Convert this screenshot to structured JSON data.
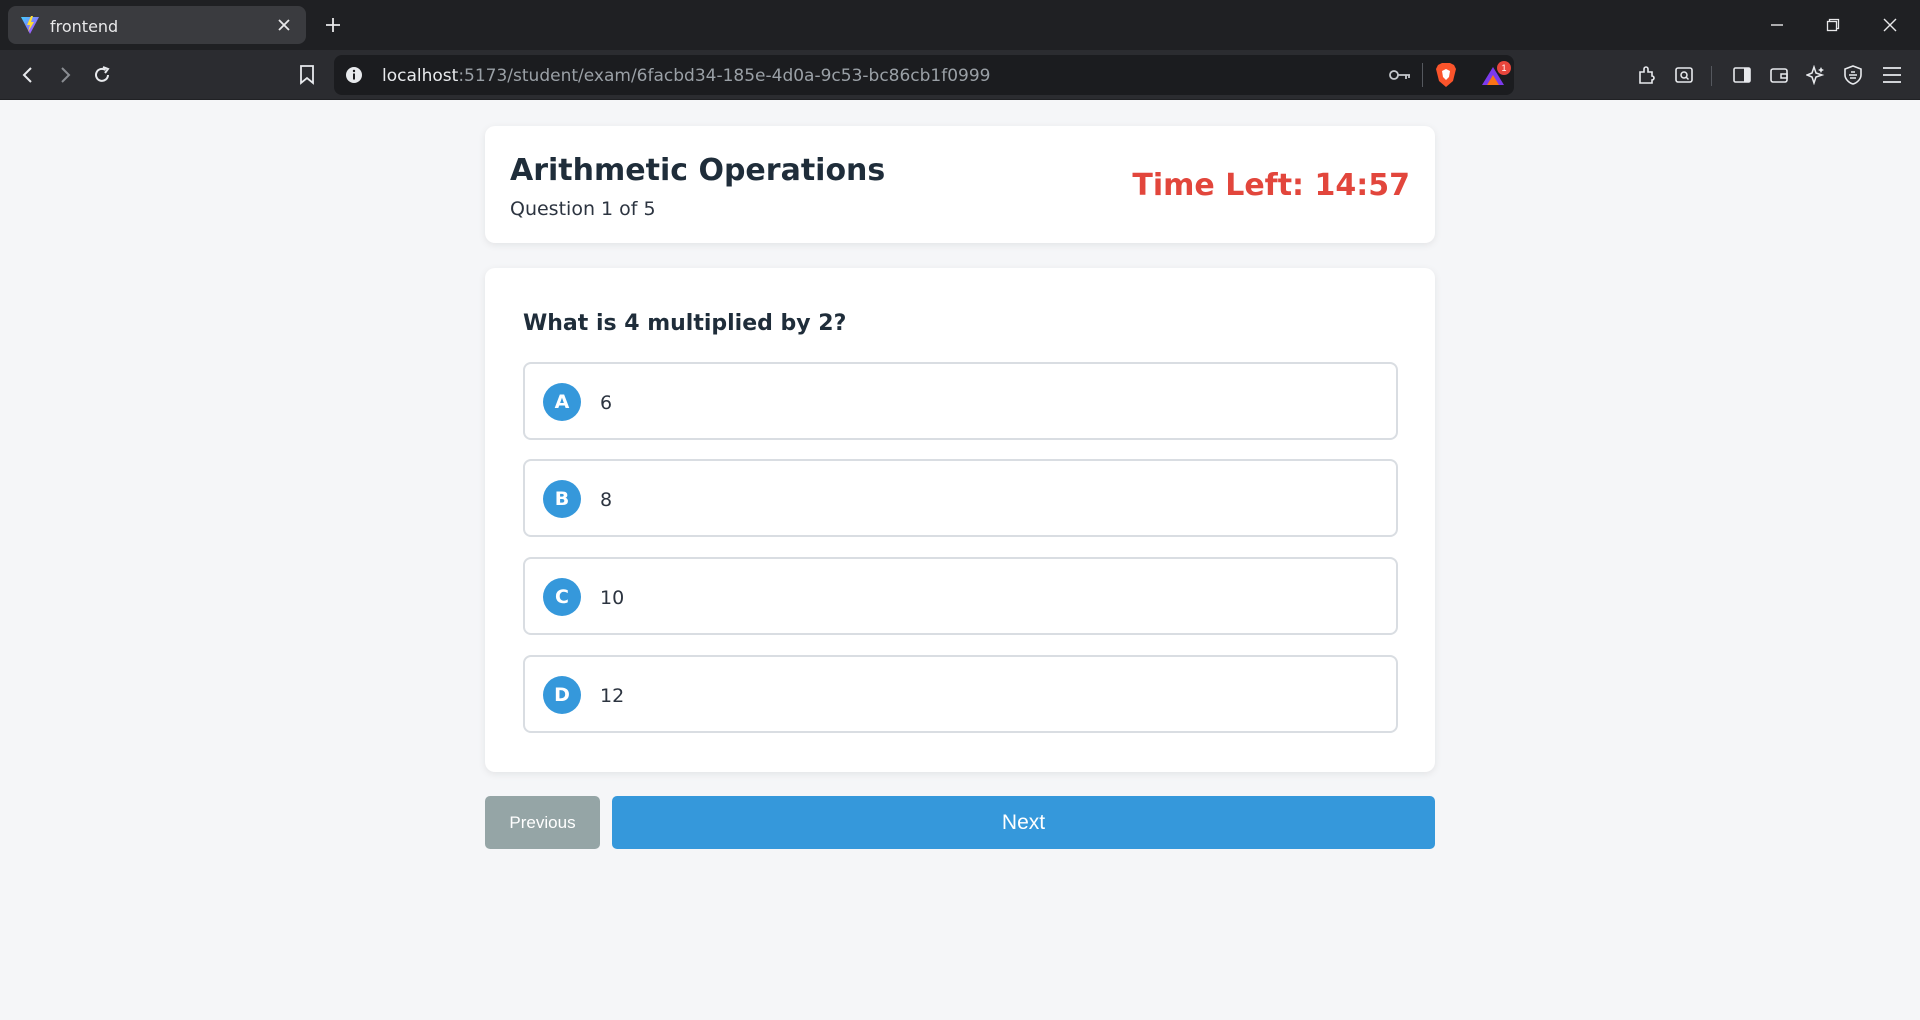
{
  "browser": {
    "tab_title": "frontend",
    "url_host": "localhost",
    "url_path": ":5173/student/exam/6facbd34-185e-4d0a-9c53-bc86cb1f0999",
    "rewards_badge": "1"
  },
  "exam": {
    "title": "Arithmetic Operations",
    "progress": "Question 1 of 5",
    "timer": "Time Left: 14:57"
  },
  "question": {
    "text": "What is 4 multiplied by 2?",
    "options": [
      {
        "letter": "A",
        "value": "6"
      },
      {
        "letter": "B",
        "value": "8"
      },
      {
        "letter": "C",
        "value": "10"
      },
      {
        "letter": "D",
        "value": "12"
      }
    ]
  },
  "navigation": {
    "previous_label": "Previous",
    "next_label": "Next"
  },
  "colors": {
    "accent": "#3598db",
    "timer": "#e2463c",
    "secondary_button": "#95a5a6"
  }
}
